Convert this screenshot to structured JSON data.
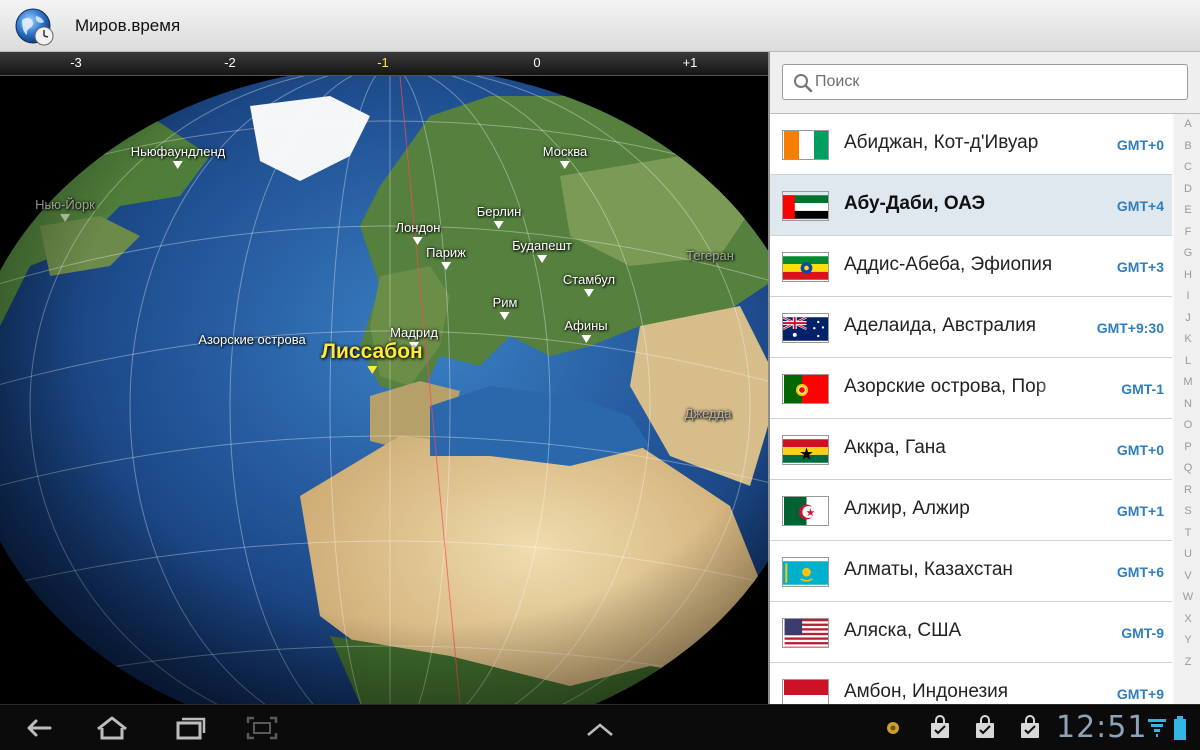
{
  "app": {
    "title": "Миров.время",
    "icon": "globe-clock-icon"
  },
  "map": {
    "timezone_offsets": [
      "-3",
      "-2",
      "-1",
      "0",
      "+1"
    ],
    "active_offset": "-1",
    "cities": [
      {
        "name": "Ньюфаундленд",
        "faded": false
      },
      {
        "name": "Нью-Йорк",
        "faded": true
      },
      {
        "name": "Москва",
        "faded": false
      },
      {
        "name": "Берлин",
        "faded": false
      },
      {
        "name": "Лондон",
        "faded": false
      },
      {
        "name": "Париж",
        "faded": false
      },
      {
        "name": "Будапешт",
        "faded": false
      },
      {
        "name": "Стамбул",
        "faded": false
      },
      {
        "name": "Тегеран",
        "faded": true
      },
      {
        "name": "Рим",
        "faded": false
      },
      {
        "name": "Афины",
        "faded": false
      },
      {
        "name": "Азорские острова",
        "faded": false
      },
      {
        "name": "Мадрид",
        "faded": false
      },
      {
        "name": "Джедда",
        "faded": true
      }
    ],
    "selected_city": "Лиссабон"
  },
  "search": {
    "placeholder": "Поиск",
    "icon": "search-icon"
  },
  "city_list": [
    {
      "name": "Абиджан, Кот-д'Ивуар",
      "gmt": "GMT+0",
      "flag": "ci"
    },
    {
      "name": "Абу-Даби, ОАЭ",
      "gmt": "GMT+4",
      "flag": "ae",
      "selected": true
    },
    {
      "name": "Аддис-Абеба, Эфиопия",
      "gmt": "GMT+3",
      "flag": "et"
    },
    {
      "name": "Аделаида, Австралия",
      "gmt": "GMT+9:30",
      "flag": "au"
    },
    {
      "name": "Азорские острова, Пор",
      "gmt": "GMT-1",
      "flag": "pt"
    },
    {
      "name": "Аккра, Гана",
      "gmt": "GMT+0",
      "flag": "gh"
    },
    {
      "name": "Алжир, Алжир",
      "gmt": "GMT+1",
      "flag": "dz"
    },
    {
      "name": "Алматы, Казахстан",
      "gmt": "GMT+6",
      "flag": "kz"
    },
    {
      "name": "Аляска, США",
      "gmt": "GMT-9",
      "flag": "us"
    },
    {
      "name": "Амбон, Индонезия",
      "gmt": "GMT+9",
      "flag": "id"
    }
  ],
  "alphabet_index": [
    "A",
    "B",
    "C",
    "D",
    "E",
    "F",
    "G",
    "H",
    "I",
    "J",
    "K",
    "L",
    "M",
    "N",
    "O",
    "P",
    "Q",
    "R",
    "S",
    "T",
    "U",
    "V",
    "W",
    "X",
    "Y",
    "Z"
  ],
  "system_bar": {
    "clock": "12:51",
    "buttons": [
      "back-icon",
      "home-icon",
      "recent-apps-icon",
      "screenshot-icon",
      "chevron-up-icon"
    ],
    "status_icons": [
      "notification-dot-icon",
      "store-bag-icon",
      "store-bag-icon",
      "store-bag-icon",
      "wifi-icon",
      "battery-icon"
    ]
  },
  "colors": {
    "accent": "#2f7ebf",
    "highlight": "#ffe93a",
    "selected_row": "#dfe7ef"
  }
}
